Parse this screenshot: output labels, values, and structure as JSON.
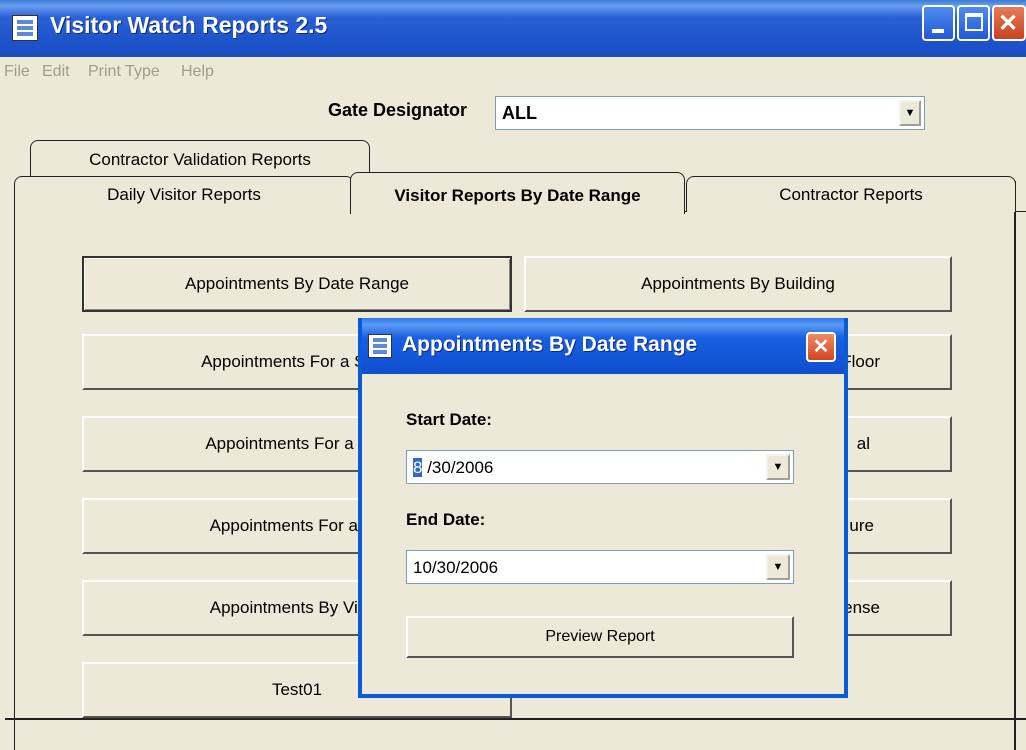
{
  "window": {
    "title": "Visitor Watch Reports 2.5",
    "minimize_label": "_",
    "maximize_label": "□",
    "close_label": "✕"
  },
  "menu": [
    "File",
    "Edit",
    "Print Type",
    "Help"
  ],
  "gate": {
    "label": "Gate Designator",
    "value": "ALL"
  },
  "tabs": {
    "row1": [
      "Contractor Validation Reports"
    ],
    "row2": [
      "Daily Visitor Reports",
      "Visitor Reports By Date Range",
      "Contractor Reports"
    ],
    "active": "Visitor Reports By Date Range"
  },
  "report_buttons": {
    "left": [
      "Appointments By Date Range",
      "Appointments For a Spec",
      "Appointments For a Spe",
      "Appointments For a De",
      "Appointments By Visito",
      "Test01"
    ],
    "right": [
      "Appointments By Building",
      "Floor",
      "al",
      "ure",
      "ense"
    ]
  },
  "dialog": {
    "title": "Appointments By Date Range",
    "close_label": "✕",
    "start_label": "Start Date:",
    "start_value_selected": "8",
    "start_value_rest": " /30/2006",
    "end_label": "End Date:",
    "end_value": "10/30/2006",
    "preview_label": "Preview Report"
  },
  "colors": {
    "titlebar": "#1d54c9",
    "window_bg": "#ece9d8",
    "dialog_border": "#0a5bd8",
    "close_button": "#d2461e"
  }
}
